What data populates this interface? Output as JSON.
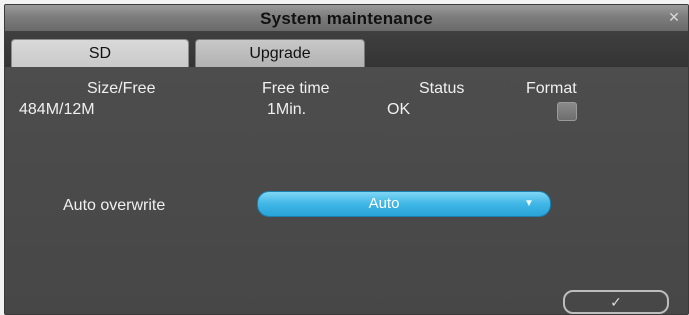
{
  "dialog": {
    "title": "System maintenance",
    "close_icon": "close-icon"
  },
  "tabs": [
    {
      "label": "SD",
      "active": true
    },
    {
      "label": "Upgrade",
      "active": false
    }
  ],
  "sd_table": {
    "headers": [
      "Size/Free",
      "Free time",
      "Status",
      "Format"
    ],
    "row": {
      "size_free": "484M/12M",
      "free_time": "1Min.",
      "status": "OK",
      "format_checked": false
    }
  },
  "auto_overwrite": {
    "label": "Auto overwrite",
    "value": "Auto",
    "accent": "#3fb6e6"
  },
  "confirm": {
    "label": "✓"
  }
}
